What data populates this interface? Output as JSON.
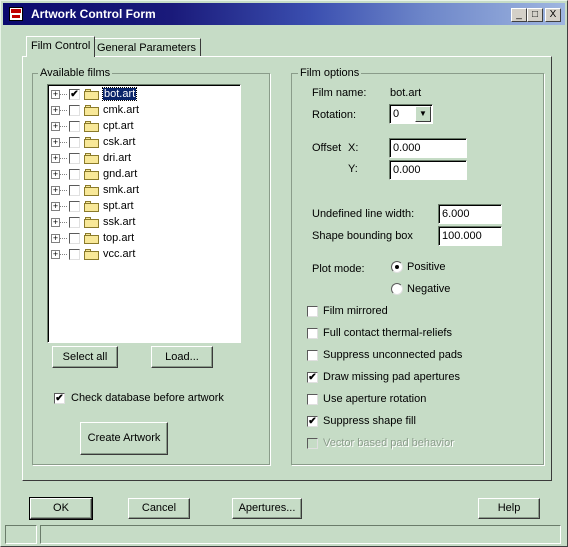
{
  "window": {
    "title": "Artwork Control Form",
    "minimize": "_",
    "maximize": "□",
    "close": "X"
  },
  "tabs": [
    {
      "label": "Film Control",
      "active": true
    },
    {
      "label": "General Parameters",
      "active": false
    }
  ],
  "available_films": {
    "label": "Available films",
    "items": [
      {
        "name": "bot.art",
        "checked": true,
        "selected": true
      },
      {
        "name": "cmk.art",
        "checked": false
      },
      {
        "name": "cpt.art",
        "checked": false
      },
      {
        "name": "csk.art",
        "checked": false
      },
      {
        "name": "dri.art",
        "checked": false
      },
      {
        "name": "gnd.art",
        "checked": false
      },
      {
        "name": "smk.art",
        "checked": false
      },
      {
        "name": "spt.art",
        "checked": false
      },
      {
        "name": "ssk.art",
        "checked": false
      },
      {
        "name": "top.art",
        "checked": false
      },
      {
        "name": "vcc.art",
        "checked": false
      }
    ],
    "select_all": "Select all",
    "load": "Load...",
    "check_db": {
      "label": "Check database before artwork",
      "checked": true
    },
    "create_artwork": "Create Artwork"
  },
  "film_options": {
    "label": "Film options",
    "film_name_label": "Film name:",
    "film_name": "bot.art",
    "rotation_label": "Rotation:",
    "rotation_value": "0",
    "offset_label": "Offset",
    "offset_x_label": "X:",
    "offset_x": "0.000",
    "offset_y_label": "Y:",
    "offset_y": "0.000",
    "undefined_line_width_label": "Undefined line width:",
    "undefined_line_width": "6.000",
    "shape_bounding_box_label": "Shape bounding box",
    "shape_bounding_box": "100.000",
    "plot_mode_label": "Plot mode:",
    "plot_mode_positive": "Positive",
    "plot_mode_negative": "Negative",
    "plot_mode_selected": "Positive",
    "checkboxes": [
      {
        "label": "Film mirrored",
        "checked": false,
        "disabled": false
      },
      {
        "label": "Full contact thermal-reliefs",
        "checked": false,
        "disabled": false
      },
      {
        "label": "Suppress unconnected pads",
        "checked": false,
        "disabled": false
      },
      {
        "label": "Draw missing pad apertures",
        "checked": true,
        "disabled": false
      },
      {
        "label": "Use aperture rotation",
        "checked": false,
        "disabled": false
      },
      {
        "label": "Suppress shape fill",
        "checked": true,
        "disabled": false
      },
      {
        "label": "Vector based pad behavior",
        "checked": false,
        "disabled": true
      }
    ]
  },
  "footer": {
    "ok": "OK",
    "cancel": "Cancel",
    "apertures": "Apertures...",
    "help": "Help"
  },
  "check_mark": "✔",
  "expander_glyph": "+"
}
